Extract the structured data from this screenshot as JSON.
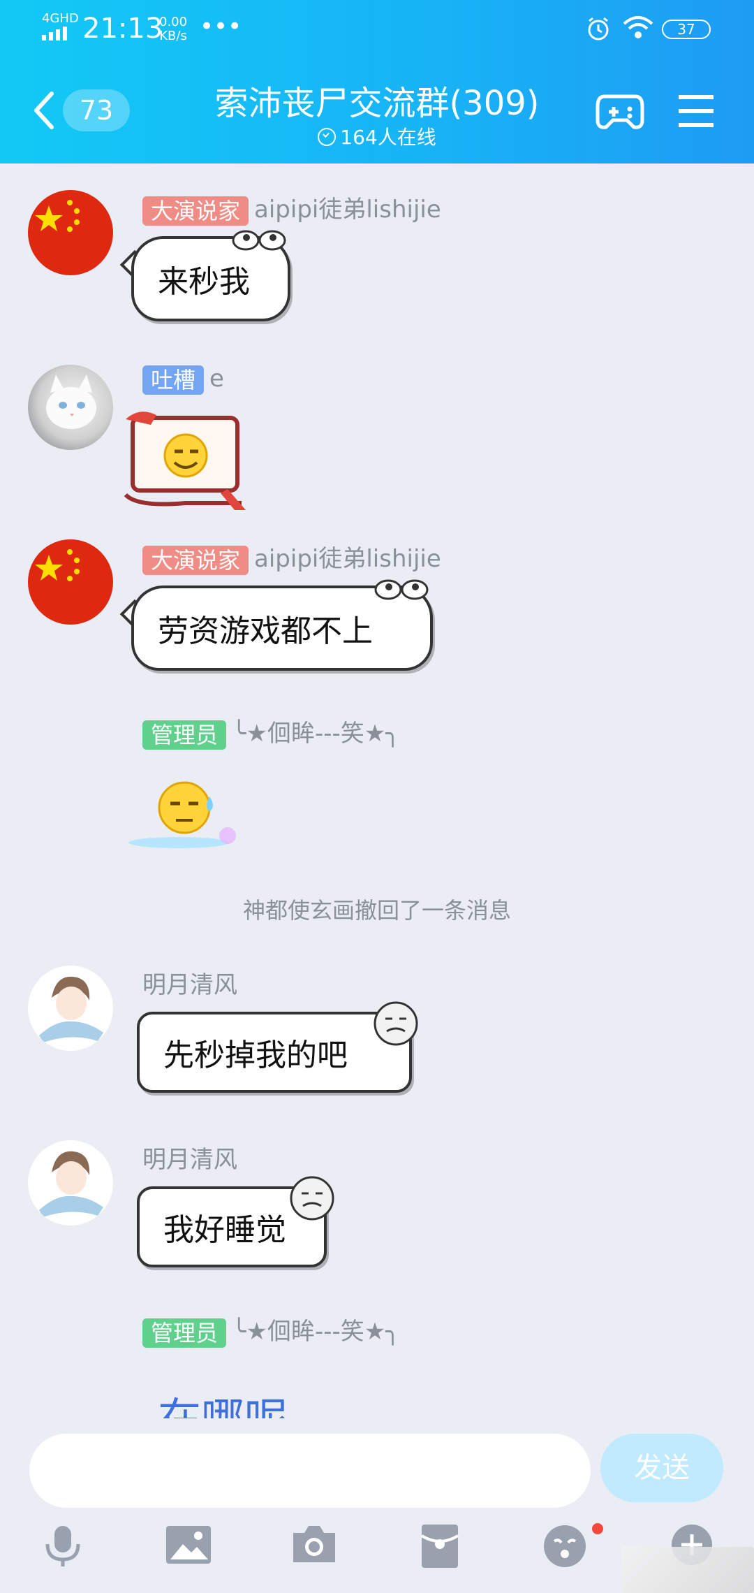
{
  "status_bar": {
    "network": "4GHD",
    "time": "21:13",
    "speed_value": "0.00",
    "speed_unit": "KB/s",
    "more": "•••",
    "battery": "37"
  },
  "header": {
    "back_count": "73",
    "title": "索沛丧尸交流群(309)",
    "online": "164人在线"
  },
  "messages": [
    {
      "tag": "大演说家",
      "tag_color": "#f08c86",
      "name": "aipipi徒弟lishijie",
      "text": "来秒我"
    },
    {
      "tag": "吐槽",
      "tag_color": "#74a5f2",
      "name": "e"
    },
    {
      "tag": "大演说家",
      "tag_color": "#f08c86",
      "name": "aipipi徒弟lishijie",
      "text": "劳资游戏都不上"
    },
    {
      "tag": "管理员",
      "tag_color": "#5fd18c",
      "name": "╰★佪眸---笑★╮"
    },
    {
      "name": "明月清风",
      "text": "先秒掉我的吧"
    },
    {
      "name": "明月清风",
      "text": "我好睡觉"
    },
    {
      "tag": "管理员",
      "tag_color": "#5fd18c",
      "name": "╰★佪眸---笑★╮",
      "text": "在哪呢"
    }
  ],
  "system_notice": "神都使玄画撤回了一条消息",
  "input": {
    "placeholder": "",
    "send_label": "发送"
  }
}
